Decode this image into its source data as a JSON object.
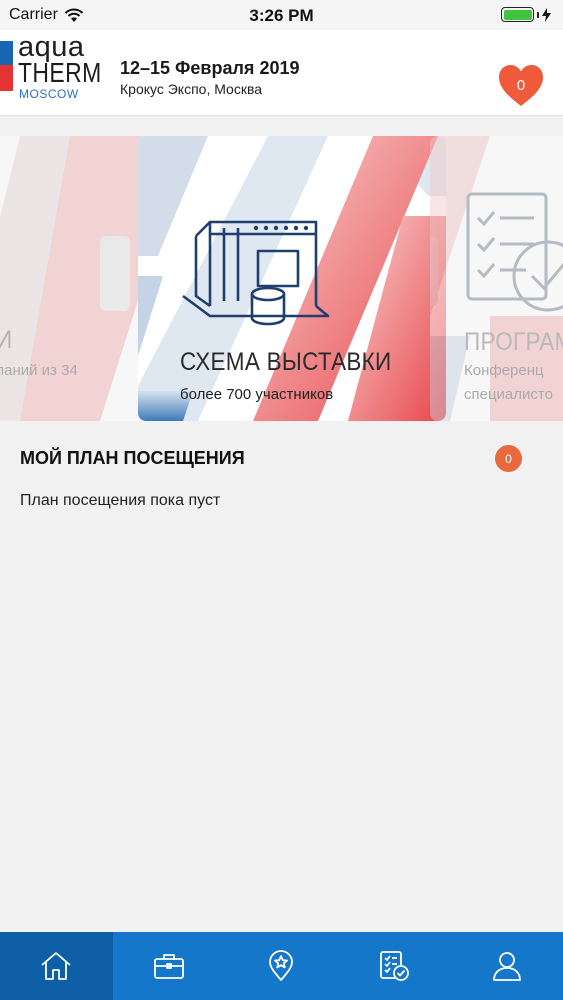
{
  "status_bar": {
    "carrier": "Carrier",
    "time": "3:26 PM"
  },
  "header": {
    "logo": {
      "line1": "aqua",
      "line2": "THERM",
      "line3": "MOSCOW"
    },
    "dates": "12–15 Февраля 2019",
    "venue": "Крокус Экспо, Москва",
    "favorites_count": "0"
  },
  "carousel": {
    "cards": [
      {
        "title": "И",
        "subtitle": "паний из 34"
      },
      {
        "title": "СХЕМА ВЫСТАВКИ",
        "subtitle": "более 700 участников"
      },
      {
        "title": "ПРОГРАМ",
        "subtitle_line1": "Конференц",
        "subtitle_line2": "специалисто"
      }
    ]
  },
  "plan": {
    "title": "МОЙ ПЛАН ПОСЕЩЕНИЯ",
    "count": "0",
    "empty_text": "План посещения пока пуст"
  },
  "tabbar": {
    "tabs": [
      {
        "icon": "home-icon",
        "active": true
      },
      {
        "icon": "briefcase-icon",
        "active": false
      },
      {
        "icon": "map-pin-star-icon",
        "active": false
      },
      {
        "icon": "checklist-icon",
        "active": false
      },
      {
        "icon": "user-icon",
        "active": false
      }
    ]
  },
  "colors": {
    "brand_blue": "#1477c9",
    "brand_red": "#e53434",
    "badge_orange": "#e86a3c"
  }
}
